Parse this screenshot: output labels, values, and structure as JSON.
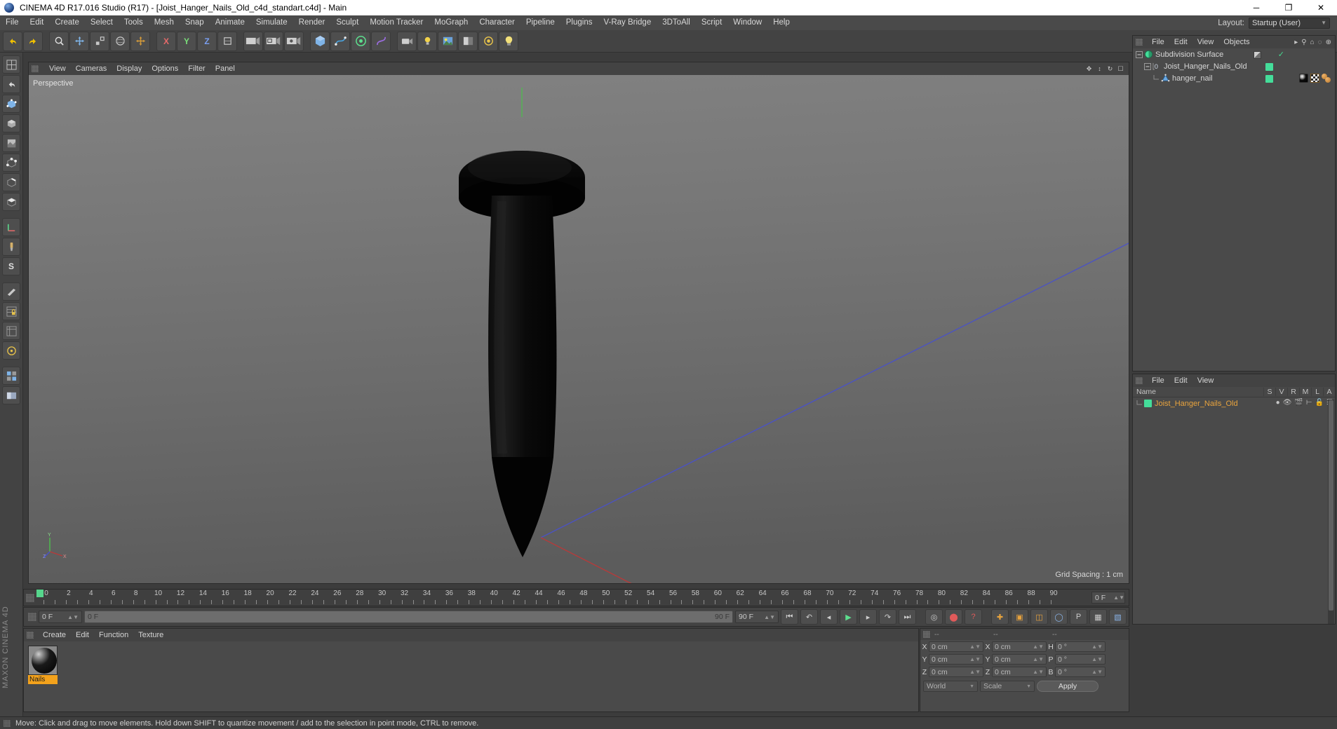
{
  "window": {
    "title": "CINEMA 4D R17.016 Studio (R17) - [Joist_Hanger_Nails_Old_c4d_standart.c4d] - Main",
    "minimize": "─",
    "maximize": "❐",
    "close": "✕"
  },
  "menubar": {
    "items": [
      "File",
      "Edit",
      "Create",
      "Select",
      "Tools",
      "Mesh",
      "Snap",
      "Animate",
      "Simulate",
      "Render",
      "Sculpt",
      "Motion Tracker",
      "MoGraph",
      "Character",
      "Pipeline",
      "Plugins",
      "V-Ray Bridge",
      "3DToAll",
      "Script",
      "Window",
      "Help"
    ],
    "layout_label": "Layout:",
    "layout_value": "Startup (User)"
  },
  "viewport": {
    "menus": [
      "View",
      "Cameras",
      "Display",
      "Options",
      "Filter",
      "Panel"
    ],
    "label": "Perspective",
    "grid_spacing": "Grid Spacing : 1 cm",
    "axis_x": "X",
    "axis_y": "Y",
    "axis_z": "Z"
  },
  "timeline": {
    "ticks": [
      0,
      2,
      4,
      6,
      8,
      10,
      12,
      14,
      16,
      18,
      20,
      22,
      24,
      26,
      28,
      30,
      32,
      34,
      36,
      38,
      40,
      42,
      44,
      46,
      48,
      50,
      52,
      54,
      56,
      58,
      60,
      62,
      64,
      66,
      68,
      70,
      72,
      74,
      76,
      78,
      80,
      82,
      84,
      86,
      88,
      90
    ],
    "current_frame_field": "0 F"
  },
  "animation": {
    "current_frame": "0 F",
    "scrub_start": "0 F",
    "scrub_end": "90 F",
    "end_frame": "90 F"
  },
  "material_manager": {
    "menus": [
      "Create",
      "Edit",
      "Function",
      "Texture"
    ],
    "materials": [
      {
        "name": "Nails"
      }
    ]
  },
  "coordinates": {
    "header": [
      "--",
      "--",
      "--"
    ],
    "position": {
      "label_x": "X",
      "label_y": "Y",
      "label_z": "Z",
      "x": "0 cm",
      "y": "0 cm",
      "z": "0 cm"
    },
    "size": {
      "label_x": "X",
      "label_y": "Y",
      "label_z": "Z",
      "x": "0 cm",
      "y": "0 cm",
      "z": "0 cm"
    },
    "rotation": {
      "label_h": "H",
      "label_p": "P",
      "label_b": "B",
      "h": "0 °",
      "p": "0 °",
      "b": "0 °"
    },
    "system": "World",
    "mode": "Scale",
    "apply": "Apply"
  },
  "object_manager": {
    "menus": [
      "File",
      "Edit",
      "View",
      "Objects"
    ],
    "rows": [
      {
        "name": "Subdivision Surface",
        "indent": 0
      },
      {
        "name": "Joist_Hanger_Nails_Old",
        "indent": 1
      },
      {
        "name": "hanger_nail",
        "indent": 2
      }
    ]
  },
  "take_manager": {
    "menus": [
      "File",
      "Edit",
      "View"
    ],
    "columns": [
      "Name",
      "S",
      "V",
      "R",
      "M",
      "L",
      "A"
    ],
    "rows": [
      {
        "name": "Joist_Hanger_Nails_Old"
      }
    ]
  },
  "statusbar": {
    "text": "Move: Click and drag to move elements. Hold down SHIFT to quantize movement / add to the selection in point mode, CTRL to remove."
  },
  "colors": {
    "accent_green": "#44dd9a",
    "accent_orange": "#e8a33d",
    "material_label": "#f3a21c",
    "panel_bg": "#4a4a4a",
    "toolbar_bg": "#434343",
    "axis_x": "#d44",
    "axis_y": "#4c4",
    "axis_z": "#4466dd"
  }
}
